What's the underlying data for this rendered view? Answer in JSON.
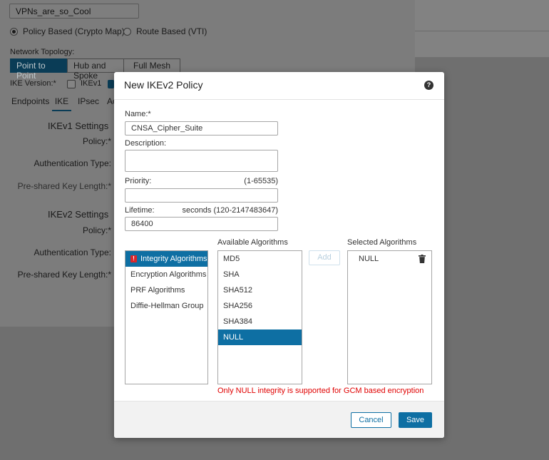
{
  "background": {
    "topology_name": "VPNs_are_so_Cool",
    "policy_types": [
      "Policy Based (Crypto Map)",
      "Route Based (VTI)"
    ],
    "network_topology_label": "Network Topology:",
    "topology_options": [
      "Point to Point",
      "Hub and Spoke",
      "Full Mesh"
    ],
    "ike_version_label": "IKE Version:*",
    "ike_v1_label": "IKEv1",
    "tabs": [
      "Endpoints",
      "IKE",
      "IPsec",
      "Ac"
    ],
    "ikev1_section": "IKEv1 Settings",
    "ikev2_section": "IKEv2 Settings",
    "policy_label": "Policy:*",
    "auth_type_label": "Authentication Type:",
    "psk_length_label": "Pre-shared Key Length:*"
  },
  "modal": {
    "title": "New IKEv2 Policy",
    "name_label": "Name:*",
    "name_value": "CNSA_Cipher_Suite",
    "description_label": "Description:",
    "description_value": "",
    "priority_label": "Priority:",
    "priority_hint": "(1-65535)",
    "priority_value": "",
    "lifetime_label": "Lifetime:",
    "lifetime_hint": "seconds (120-2147483647)",
    "lifetime_value": "86400",
    "categories": [
      "Integrity Algorithms",
      "Encryption Algorithms",
      "PRF Algorithms",
      "Diffie-Hellman Group"
    ],
    "available_title": "Available Algorithms",
    "available": [
      "MD5",
      "SHA",
      "SHA512",
      "SHA256",
      "SHA384",
      "NULL"
    ],
    "add_label": "Add",
    "selected_title": "Selected Algorithms",
    "selected": [
      "NULL"
    ],
    "error_message": "Only NULL integrity is supported for GCM based encryption",
    "error_badge": "!",
    "help_glyph": "?",
    "cancel_label": "Cancel",
    "save_label": "Save"
  },
  "icons": {
    "help": "help-icon",
    "trash": "trash-icon",
    "error": "error-icon"
  },
  "colors": {
    "accent": "#0e6fa3",
    "error": "#e00000"
  }
}
